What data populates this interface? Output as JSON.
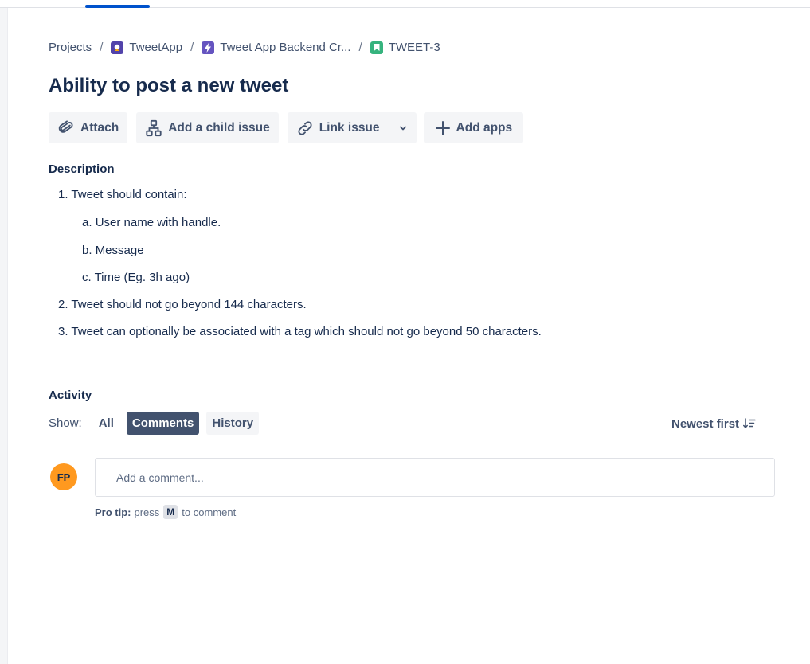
{
  "breadcrumb": {
    "items": [
      {
        "label": "Projects",
        "icon": ""
      },
      {
        "label": "TweetApp",
        "icon": "project-avatar-icon",
        "icon_color": "#5243AA"
      },
      {
        "label": "Tweet App Backend Cr...",
        "icon": "epic-icon",
        "icon_color": "#6554C0"
      },
      {
        "label": "TWEET-3",
        "icon": "story-icon",
        "icon_color": "#36B37E"
      }
    ],
    "separator": "/"
  },
  "issue": {
    "title": "Ability to post a new tweet"
  },
  "toolbar": {
    "attach_label": "Attach",
    "child_issue_label": "Add a child issue",
    "link_issue_label": "Link issue",
    "add_apps_label": "Add apps"
  },
  "description": {
    "heading": "Description",
    "items": [
      {
        "marker": "1.",
        "text": "Tweet should contain:"
      },
      {
        "marker": "a.",
        "text": "User name with handle."
      },
      {
        "marker": "b.",
        "text": "Message"
      },
      {
        "marker": "c.",
        "text": "Time (Eg. 3h ago)"
      },
      {
        "marker": "2.",
        "text": "Tweet should not go beyond 144 characters."
      },
      {
        "marker": "3.",
        "text": "Tweet can optionally be associated with a tag which should not go beyond 50 characters."
      }
    ]
  },
  "activity": {
    "heading": "Activity",
    "show_label": "Show:",
    "filters": [
      "All",
      "Comments",
      "History"
    ],
    "selected_filter": "Comments",
    "sort_label": "Newest first"
  },
  "comment": {
    "avatar_initials": "FP",
    "placeholder": "Add a comment...",
    "pro_tip_label": "Pro tip:",
    "pro_tip_before": "press",
    "pro_tip_key": "M",
    "pro_tip_after": "to comment"
  },
  "colors": {
    "accent": "#0052CC",
    "avatar_bg": "#FF991F",
    "selected_filter_bg": "#42526E"
  }
}
